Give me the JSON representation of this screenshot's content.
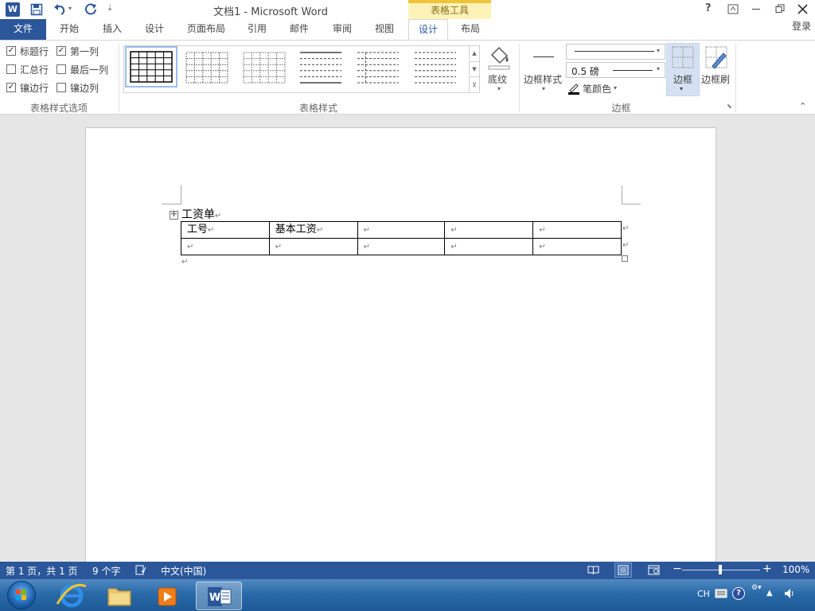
{
  "window": {
    "title": "文档1 - Microsoft Word",
    "context_tab_group": "表格工具"
  },
  "quick_access": {
    "word_icon": "W",
    "save": "save-icon",
    "undo": "undo-icon",
    "redo": "redo-icon",
    "customize": "⇣"
  },
  "window_controls": {
    "help": "?",
    "ribbon_options": "ribbon-display-options-icon",
    "minimize": "minimize-icon",
    "restore": "restore-icon",
    "close": "close-icon"
  },
  "tabs": {
    "file": "文件",
    "home": "开始",
    "insert": "插入",
    "design": "设计",
    "layout": "页面布局",
    "references": "引用",
    "mailings": "邮件",
    "review": "审阅",
    "view": "视图",
    "table_design": "设计",
    "table_layout": "布局",
    "login": "登录"
  },
  "ribbon": {
    "style_options": {
      "group_label": "表格样式选项",
      "header_row": {
        "label": "标题行",
        "checked": true
      },
      "first_column": {
        "label": "第一列",
        "checked": true
      },
      "total_row": {
        "label": "汇总行",
        "checked": false
      },
      "last_column": {
        "label": "最后一列",
        "checked": false
      },
      "banded_rows": {
        "label": "镶边行",
        "checked": true
      },
      "banded_columns": {
        "label": "镶边列",
        "checked": false
      }
    },
    "table_styles": {
      "group_label": "表格样式",
      "shading": "底纹",
      "gallery_count": 6
    },
    "borders": {
      "group_label": "边框",
      "border_styles": "边框样式",
      "line_weight": "0.5 磅",
      "pen_color": "笔颜色",
      "borders_button": "边框",
      "border_painter": "边框刷"
    }
  },
  "document": {
    "heading": "工资单",
    "table": {
      "rows": [
        [
          "工号",
          "基本工资",
          "",
          "",
          ""
        ],
        [
          "",
          "",
          "",
          "",
          ""
        ]
      ]
    },
    "paragraph_mark": "↵"
  },
  "statusbar": {
    "page": "第 1 页，共 1 页",
    "words": "9 个字",
    "language": "中文(中国)",
    "zoom": "100%",
    "zoom_level": 1.0
  },
  "taskbar": {
    "lang": "CH"
  },
  "colors": {
    "accent": "#2b579a",
    "context_tab": "#fdf2b8",
    "selected_gallery_border": "#9dbde8"
  }
}
